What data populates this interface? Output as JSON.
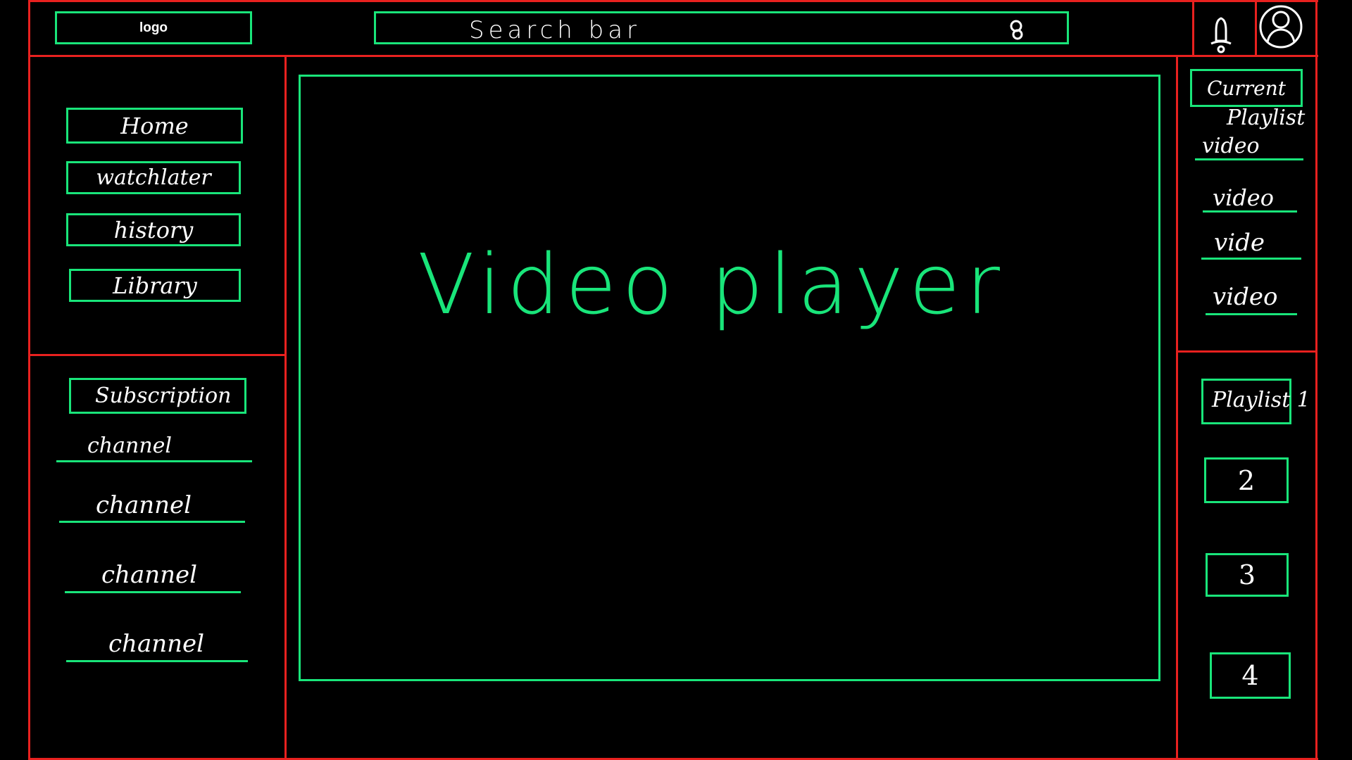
{
  "header": {
    "logo_label": "logo",
    "search_label": "Search bar",
    "search_icon": "magnifier-icon",
    "bell_icon": "bell-icon",
    "profile_icon": "user-icon"
  },
  "sidebar": {
    "nav": [
      {
        "label": "Home"
      },
      {
        "label": "watchlater"
      },
      {
        "label": "history"
      },
      {
        "label": "Library"
      }
    ],
    "subscriptions_label": "Subscription",
    "channels": [
      {
        "label": "channel"
      },
      {
        "label": "channel"
      },
      {
        "label": "channel"
      },
      {
        "label": "channel"
      }
    ]
  },
  "player": {
    "label": "Video player"
  },
  "right_panel": {
    "current_label": "Current",
    "playlist_heading": "Playlist",
    "videos": [
      {
        "label": "video"
      },
      {
        "label": "video"
      },
      {
        "label": "vide"
      },
      {
        "label": "video"
      }
    ],
    "playlists": [
      {
        "label": "Playlist 1"
      },
      {
        "label": "2"
      },
      {
        "label": "3"
      },
      {
        "label": "4"
      }
    ]
  },
  "colors": {
    "frame": "#e8211f",
    "wireframe": "#19e57a",
    "background": "#000000",
    "text": "#ffffff"
  }
}
